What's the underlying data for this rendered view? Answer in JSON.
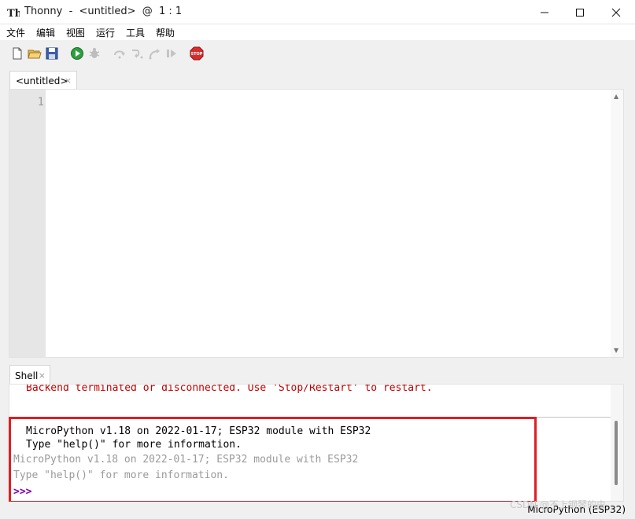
{
  "window": {
    "title": "Thonny  -  <untitled>  @  1 : 1",
    "logo_icon": "thonny-logo-icon",
    "controls": [
      "minimize-icon",
      "maximize-icon",
      "close-icon"
    ]
  },
  "menu": [
    "文件",
    "编辑",
    "视图",
    "运行",
    "工具",
    "帮助"
  ],
  "toolbar": {
    "icons": [
      "new-file-icon",
      "open-folder-icon",
      "save-icon",
      "run-icon",
      "debug-icon",
      "step-over-icon",
      "step-into-icon",
      "step-out-icon",
      "resume-icon",
      "stop-icon"
    ],
    "stop_label": "STOP"
  },
  "editor": {
    "tab_label": "<untitled>",
    "tab_close": "×",
    "line_numbers": [
      "1"
    ]
  },
  "shell": {
    "tab_label": "Shell",
    "tab_close": "×",
    "error_line": "Backend terminated or disconnected. Use 'Stop/Restart' to restart.",
    "banner_line1": "MicroPython v1.18 on 2022-01-17; ESP32 module with ESP32",
    "banner_line2": "Type \"help()\" for more information.",
    "echo_line1": "MicroPython v1.18 on 2022-01-17; ESP32 module with ESP32",
    "echo_line2": "Type \"help()\" for more information.",
    "prompt": ">>>"
  },
  "status": {
    "interpreter": "MicroPython (ESP32)",
    "watermark": "CSDN @不上钢琴的虫"
  },
  "colors": {
    "error": "#c00000",
    "prompt": "#8000a0",
    "highlight_box": "#e01e25"
  }
}
